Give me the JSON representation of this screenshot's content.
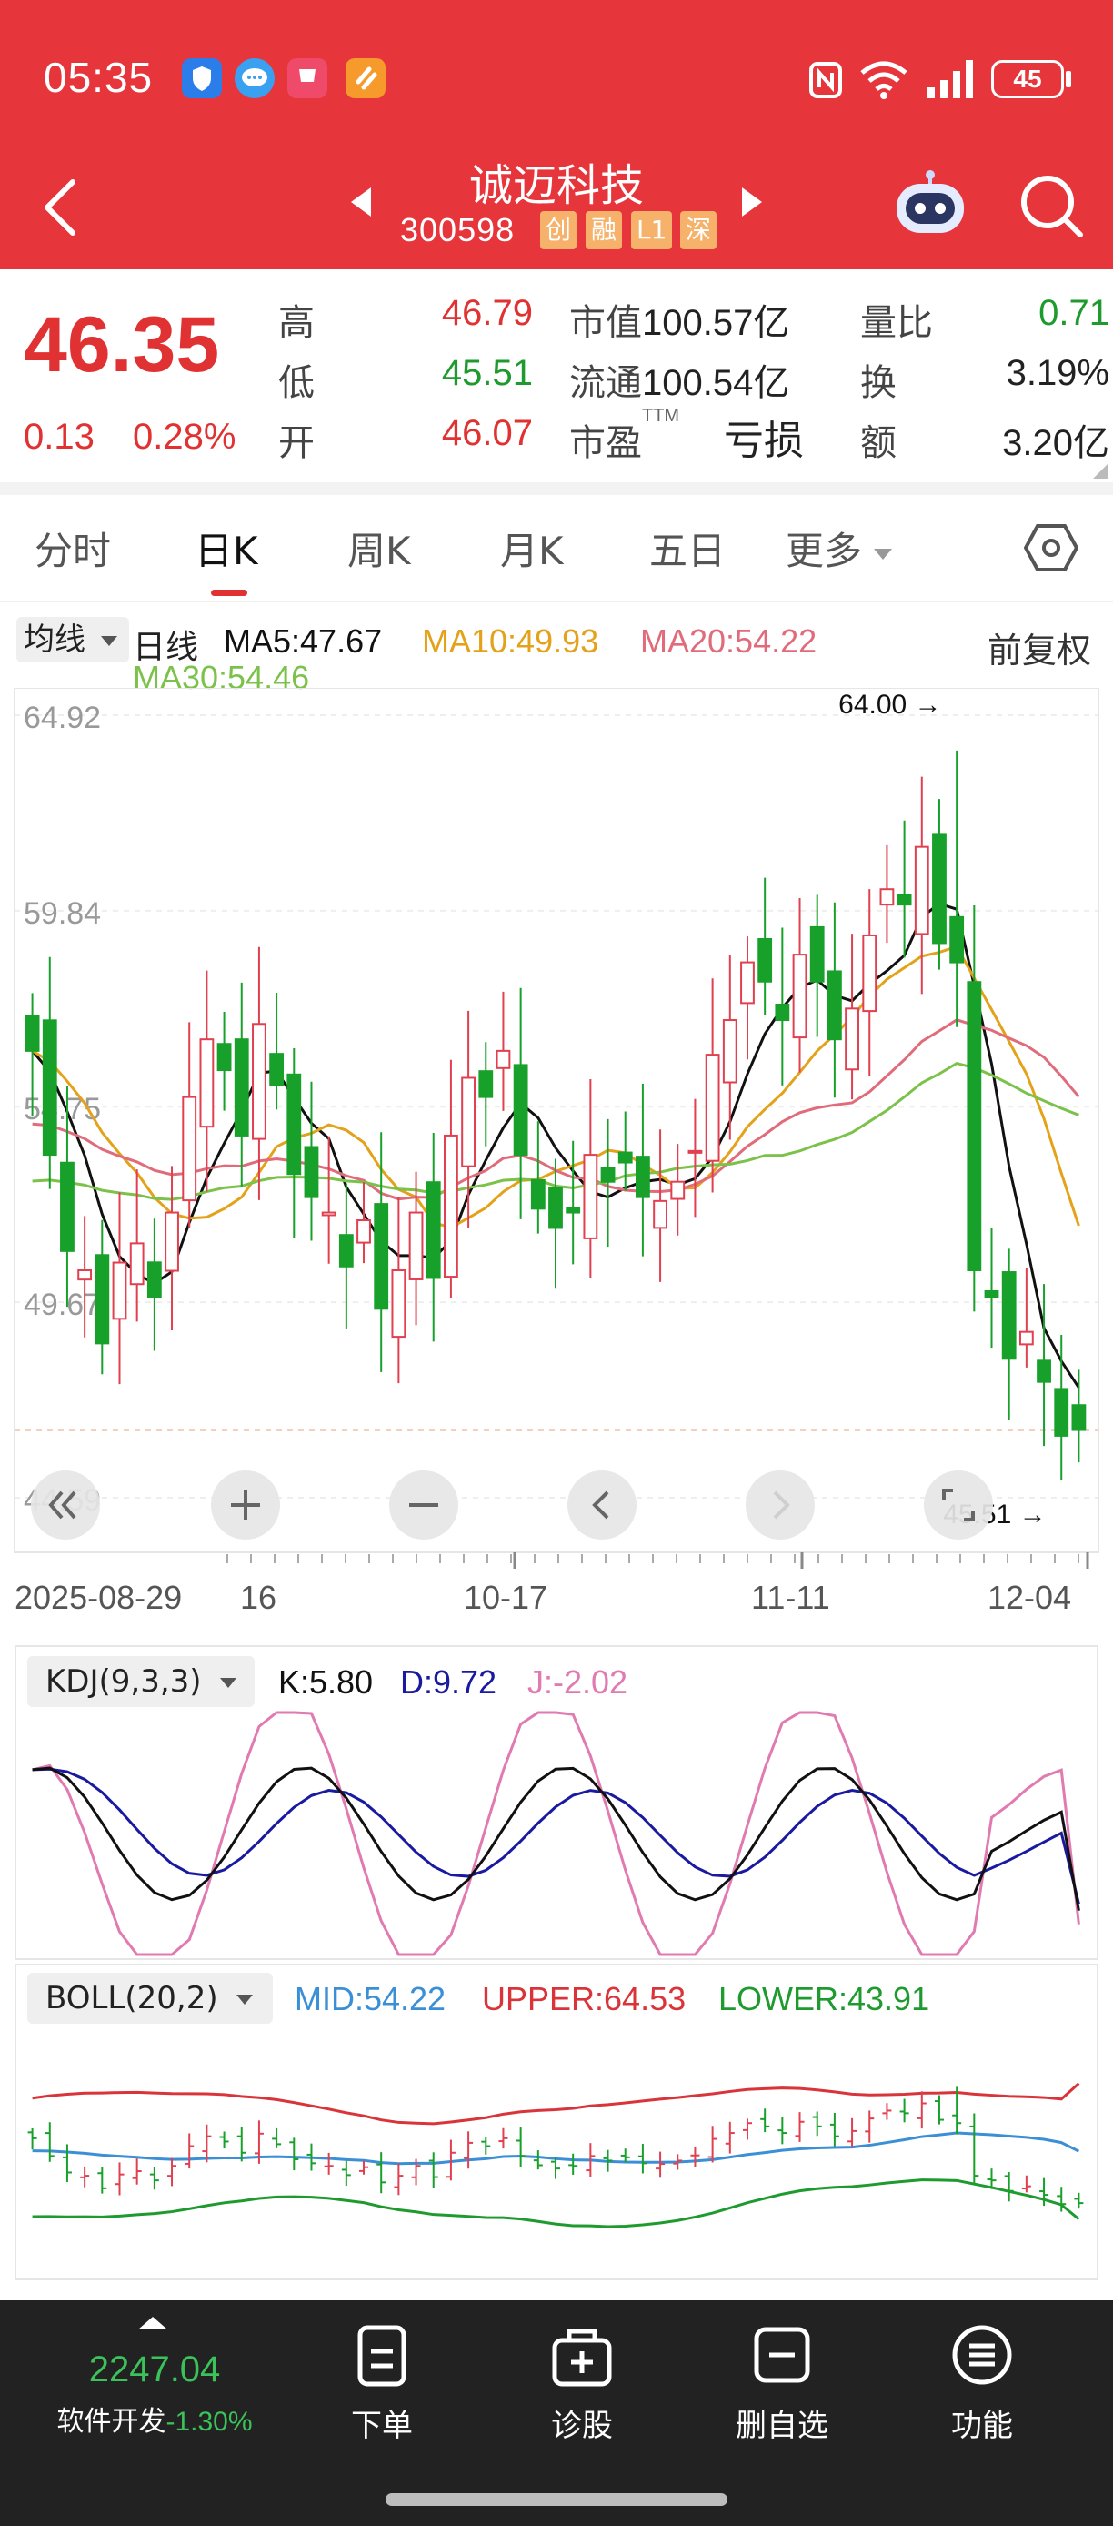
{
  "status_bar": {
    "time": "05:35",
    "battery": "45",
    "icons": [
      "shield-app-icon",
      "message-app-icon",
      "app-gallery-icon",
      "orange-app-icon",
      "nfc-icon",
      "wifi-icon",
      "signal-icon",
      "battery-icon"
    ],
    "app_gallery_text": "App Gallery"
  },
  "header": {
    "stock_name": "诚迈科技",
    "stock_code": "300598",
    "tags": [
      "创",
      "融",
      "L1",
      "深"
    ],
    "colors": {
      "bar": "#e7353c",
      "tag": "#f6b26b"
    }
  },
  "quote": {
    "price": "46.35",
    "change": "0.13",
    "change_pct": "0.28%",
    "high_label": "高",
    "high": "46.79",
    "low_label": "低",
    "low": "45.51",
    "open_label": "开",
    "open": "46.07",
    "mcap_label": "市值",
    "mcap": "100.57亿",
    "float_label": "流通",
    "float": "100.54亿",
    "pe_label": "市盈",
    "pe_sup": "TTM",
    "pe": "亏损",
    "vol_ratio_label": "量比",
    "vol_ratio": "0.71",
    "turnover_label": "换",
    "turnover": "3.19%",
    "amount_label": "额",
    "amount": "3.20亿"
  },
  "tabs": [
    "分时",
    "日K",
    "周K",
    "月K",
    "五日",
    "更多"
  ],
  "active_tab": "日K",
  "chart": {
    "ma_select": "均线",
    "period_label": "日线",
    "ma5": "MA5:47.67",
    "ma10": "MA10:49.93",
    "ma20": "MA20:54.22",
    "ma30": "MA30:54.46",
    "adjust": "前复权",
    "y_ticks": [
      "64.92",
      "59.84",
      "54.75",
      "49.67",
      "44.59"
    ],
    "high_marker": "64.00",
    "low_marker": "45.51",
    "dates": [
      "2025-08-29",
      "16",
      "10-17",
      "11-11",
      "12-04"
    ],
    "colors": {
      "up": "#e0404f",
      "down": "#18a12a",
      "ma5": "#111111",
      "ma10": "#e3a21a",
      "ma20": "#e06b7a",
      "ma30": "#7cc24a"
    }
  },
  "kdj": {
    "select": "KDJ(9,3,3)",
    "k": "K:5.80",
    "d": "D:9.72",
    "j": "J:-2.02",
    "colors": {
      "k": "#111111",
      "d": "#1a1aa0",
      "j": "#e07ab0"
    }
  },
  "boll": {
    "select": "BOLL(20,2)",
    "mid": "MID:54.22",
    "upper": "UPPER:64.53",
    "lower": "LOWER:43.91",
    "colors": {
      "mid": "#3b8fd6",
      "upper": "#d9343a",
      "lower": "#1f9a2e"
    }
  },
  "chart_data": {
    "type": "candlestick",
    "ylim": [
      44.59,
      64.92
    ],
    "last_close": 46.35,
    "closes": [
      56.2,
      53.5,
      51.0,
      50.5,
      48.6,
      50.7,
      51.2,
      49.8,
      52.0,
      55.0,
      56.5,
      55.7,
      54.0,
      56.9,
      55.3,
      53.0,
      52.4,
      52.0,
      50.6,
      51.8,
      49.5,
      50.5,
      52.0,
      50.3,
      54.0,
      55.5,
      55.0,
      56.2,
      53.5,
      52.1,
      51.6,
      52.0,
      53.5,
      52.8,
      53.3,
      52.4,
      52.3,
      52.8,
      53.6,
      56.1,
      57.0,
      58.5,
      58.0,
      57.0,
      58.7,
      58.0,
      56.5,
      57.3,
      59.2,
      60.4,
      60.0,
      61.5,
      59.0,
      58.5,
      50.5,
      49.8,
      48.2,
      48.9,
      47.6,
      46.2,
      46.35
    ],
    "kdj_k": 5.8,
    "kdj_d": 9.72,
    "kdj_j": -2.02,
    "boll_mid": 54.22,
    "boll_upper": 64.53,
    "boll_lower": 43.91
  },
  "bottom_nav": {
    "index_value": "2247.04",
    "index_name": "软件开发",
    "index_change": "-1.30%",
    "items": [
      "下单",
      "诊股",
      "删自选",
      "功能"
    ]
  }
}
